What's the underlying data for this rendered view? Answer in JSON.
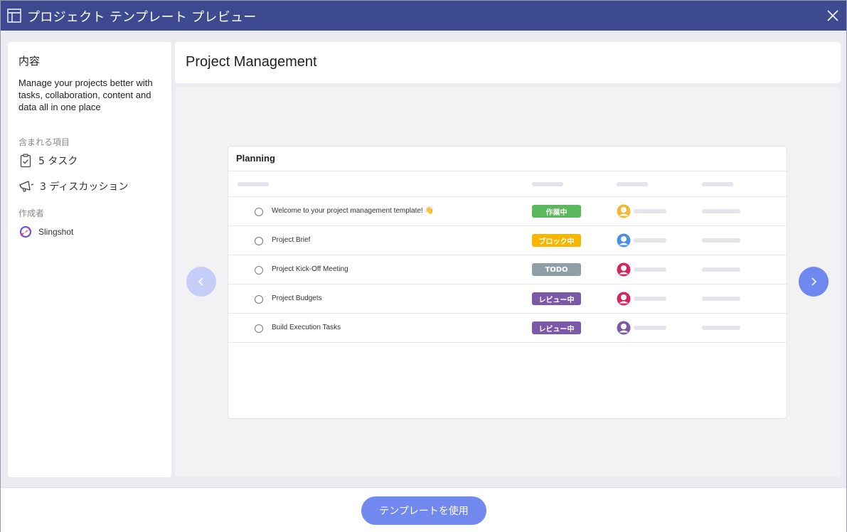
{
  "window": {
    "title": "プロジェクト テンプレート プレビュー"
  },
  "sidebar": {
    "heading": "内容",
    "description": "Manage your projects better with tasks, collaboration, content and data all in one place",
    "included_label": "含まれる項目",
    "tasks_label": "5 タスク",
    "discussions_label": "3 ディスカッション",
    "creator_label": "作成者",
    "creator_name": "Slingshot"
  },
  "main": {
    "title": "Project Management"
  },
  "preview": {
    "card_title": "Planning",
    "rows": [
      {
        "name": "Welcome to your project management template! 👋",
        "status": "作業中",
        "status_color": "#5cb85c",
        "avatar_color": "#f5b731"
      },
      {
        "name": "Project Brief",
        "status": "ブロック中",
        "status_color": "#f7b500",
        "avatar_color": "#4a90e2"
      },
      {
        "name": "Project Kick-Off Meeting",
        "status": "TODO",
        "status_color": "#8f9fa8",
        "avatar_color": "#d6245d"
      },
      {
        "name": "Project Budgets",
        "status": "レビュー中",
        "status_color": "#7b59a8",
        "avatar_color": "#d6245d"
      },
      {
        "name": "Build Execution Tasks",
        "status": "レビュー中",
        "status_color": "#7b59a8",
        "avatar_color": "#7b59a8"
      }
    ]
  },
  "footer": {
    "use_button_label": "テンプレートを使用"
  },
  "icons": {
    "window": "layout-icon",
    "close": "close-icon",
    "tasks": "clipboard-check-icon",
    "discussions": "megaphone-icon",
    "creator": "rocket-logo-icon",
    "prev": "chevron-left-icon",
    "next": "chevron-right-icon"
  },
  "colors": {
    "titlebar": "#3d4a8f",
    "accent": "#7188ee"
  }
}
